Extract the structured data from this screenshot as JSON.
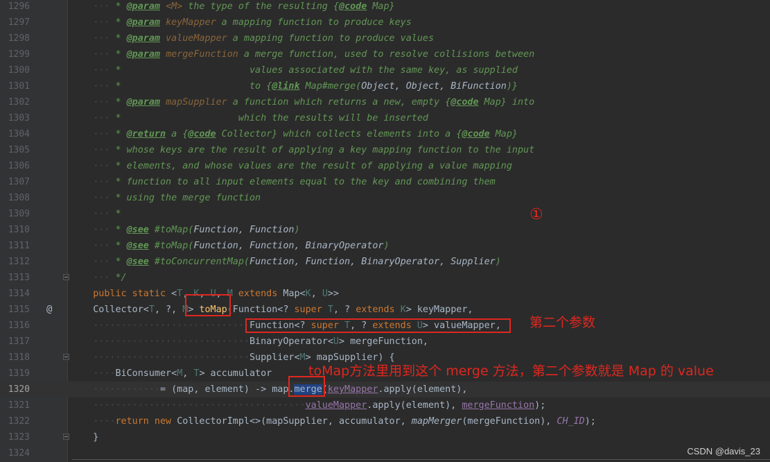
{
  "lines": [
    {
      "n": "1296",
      "tokens": [
        [
          "ws",
          "    ···"
        ],
        [
          "doc",
          " * "
        ],
        [
          "tag",
          "@param"
        ],
        [
          "doc",
          " "
        ],
        [
          "param",
          "<M>"
        ],
        [
          "doc",
          " the type of the resulting {"
        ],
        [
          "tag",
          "@code"
        ],
        [
          "doc",
          " Map}"
        ]
      ]
    },
    {
      "n": "1297",
      "tokens": [
        [
          "ws",
          "    ···"
        ],
        [
          "doc",
          " * "
        ],
        [
          "tag",
          "@param"
        ],
        [
          "doc",
          " "
        ],
        [
          "param",
          "keyMapper"
        ],
        [
          "doc",
          " a mapping function to produce keys"
        ]
      ]
    },
    {
      "n": "1298",
      "tokens": [
        [
          "ws",
          "    ···"
        ],
        [
          "doc",
          " * "
        ],
        [
          "tag",
          "@param"
        ],
        [
          "doc",
          " "
        ],
        [
          "param",
          "valueMapper"
        ],
        [
          "doc",
          " a mapping function to produce values"
        ]
      ]
    },
    {
      "n": "1299",
      "tokens": [
        [
          "ws",
          "    ···"
        ],
        [
          "doc",
          " * "
        ],
        [
          "tag",
          "@param"
        ],
        [
          "doc",
          " "
        ],
        [
          "param",
          "mergeFunction"
        ],
        [
          "doc",
          " a merge function, used to resolve collisions between"
        ]
      ]
    },
    {
      "n": "1300",
      "tokens": [
        [
          "ws",
          "    ···"
        ],
        [
          "doc",
          " *                       values associated with the same key, as supplied"
        ]
      ]
    },
    {
      "n": "1301",
      "tokens": [
        [
          "ws",
          "    ···"
        ],
        [
          "doc",
          " *                       to {"
        ],
        [
          "tag",
          "@link"
        ],
        [
          "doc",
          " Map#"
        ],
        [
          "doc",
          "merge"
        ],
        [
          "doc",
          "("
        ],
        [
          "it",
          "Object, Object, BiFunction"
        ],
        [
          "doc",
          ")}"
        ]
      ]
    },
    {
      "n": "1302",
      "tokens": [
        [
          "ws",
          "    ···"
        ],
        [
          "doc",
          " * "
        ],
        [
          "tag",
          "@param"
        ],
        [
          "doc",
          " "
        ],
        [
          "param",
          "mapSupplier"
        ],
        [
          "doc",
          " a function which returns a new, empty {"
        ],
        [
          "tag",
          "@code"
        ],
        [
          "doc",
          " Map} into"
        ]
      ]
    },
    {
      "n": "1303",
      "tokens": [
        [
          "ws",
          "    ···"
        ],
        [
          "doc",
          " *                     which the results will be inserted"
        ]
      ]
    },
    {
      "n": "1304",
      "tokens": [
        [
          "ws",
          "    ···"
        ],
        [
          "doc",
          " * "
        ],
        [
          "tag",
          "@return"
        ],
        [
          "doc",
          " a {"
        ],
        [
          "tag",
          "@code"
        ],
        [
          "doc",
          " Collector} which collects elements into a {"
        ],
        [
          "tag",
          "@code"
        ],
        [
          "doc",
          " Map}"
        ]
      ]
    },
    {
      "n": "1305",
      "tokens": [
        [
          "ws",
          "    ···"
        ],
        [
          "doc",
          " * whose keys are the result of applying a key mapping function to the input"
        ]
      ]
    },
    {
      "n": "1306",
      "tokens": [
        [
          "ws",
          "    ···"
        ],
        [
          "doc",
          " * elements, and whose values are the result of applying a value mapping"
        ]
      ]
    },
    {
      "n": "1307",
      "tokens": [
        [
          "ws",
          "    ···"
        ],
        [
          "doc",
          " * function to all input elements equal to the key and combining them"
        ]
      ]
    },
    {
      "n": "1308",
      "tokens": [
        [
          "ws",
          "    ···"
        ],
        [
          "doc",
          " * using the merge function"
        ]
      ]
    },
    {
      "n": "1309",
      "tokens": [
        [
          "ws",
          "    ···"
        ],
        [
          "doc",
          " *"
        ]
      ]
    },
    {
      "n": "1310",
      "tokens": [
        [
          "ws",
          "    ···"
        ],
        [
          "doc",
          " * "
        ],
        [
          "tag",
          "@see"
        ],
        [
          "doc",
          " #toMap("
        ],
        [
          "it",
          "Function, Function"
        ],
        [
          "doc",
          ")"
        ]
      ]
    },
    {
      "n": "1311",
      "tokens": [
        [
          "ws",
          "    ···"
        ],
        [
          "doc",
          " * "
        ],
        [
          "tag",
          "@see"
        ],
        [
          "doc",
          " #toMap("
        ],
        [
          "it",
          "Function, Function, BinaryOperator"
        ],
        [
          "doc",
          ")"
        ]
      ]
    },
    {
      "n": "1312",
      "tokens": [
        [
          "ws",
          "    ···"
        ],
        [
          "doc",
          " * "
        ],
        [
          "tag",
          "@see"
        ],
        [
          "doc",
          " #toConcurrentMap("
        ],
        [
          "it",
          "Function, Function, BinaryOperator, Supplier"
        ],
        [
          "doc",
          ")"
        ]
      ]
    },
    {
      "n": "1313",
      "tokens": [
        [
          "ws",
          "    ···"
        ],
        [
          "doc",
          " */"
        ]
      ]
    },
    {
      "n": "1314",
      "tokens": [
        [
          "ws",
          "    "
        ],
        [
          "kw",
          "public static "
        ],
        [
          "plain",
          "<"
        ],
        [
          "tp",
          "T"
        ],
        [
          "plain",
          ", "
        ],
        [
          "tp",
          "K"
        ],
        [
          "plain",
          ", "
        ],
        [
          "tp",
          "U"
        ],
        [
          "plain",
          ", "
        ],
        [
          "tp",
          "M "
        ],
        [
          "kw",
          "extends "
        ],
        [
          "plain",
          "Map<"
        ],
        [
          "tp",
          "K"
        ],
        [
          "plain",
          ", "
        ],
        [
          "tp",
          "U"
        ],
        [
          "plain",
          ">>"
        ]
      ]
    },
    {
      "n": "1315",
      "tokens": [
        [
          "ws",
          "    "
        ],
        [
          "plain",
          "Collector<"
        ],
        [
          "tp",
          "T"
        ],
        [
          "plain",
          ", ?, "
        ],
        [
          "tp",
          "M"
        ],
        [
          "plain",
          "> "
        ],
        [
          "fn",
          "toMap"
        ],
        [
          "plain",
          "(Function<? "
        ],
        [
          "kw",
          "super "
        ],
        [
          "tp",
          "T"
        ],
        [
          "plain",
          ", ? "
        ],
        [
          "kw",
          "extends "
        ],
        [
          "tp",
          "K"
        ],
        [
          "plain",
          "> keyMapper,"
        ]
      ]
    },
    {
      "n": "1316",
      "tokens": [
        [
          "ws",
          "    ····························"
        ],
        [
          "plain",
          "Function<? "
        ],
        [
          "kw",
          "super "
        ],
        [
          "tp",
          "T"
        ],
        [
          "plain",
          ", ? "
        ],
        [
          "kw",
          "extends "
        ],
        [
          "tp",
          "U"
        ],
        [
          "plain",
          "> valueMapper,"
        ]
      ]
    },
    {
      "n": "1317",
      "tokens": [
        [
          "ws",
          "    ····························"
        ],
        [
          "plain",
          "BinaryOperator<"
        ],
        [
          "tp",
          "U"
        ],
        [
          "plain",
          "> mergeFunction,"
        ]
      ]
    },
    {
      "n": "1318",
      "tokens": [
        [
          "ws",
          "    ····························"
        ],
        [
          "plain",
          "Supplier<"
        ],
        [
          "tp",
          "M"
        ],
        [
          "plain",
          "> mapSupplier) {"
        ]
      ]
    },
    {
      "n": "1319",
      "tokens": [
        [
          "ws",
          "    ····"
        ],
        [
          "plain",
          "BiConsumer<"
        ],
        [
          "tp",
          "M"
        ],
        [
          "plain",
          ", "
        ],
        [
          "tp",
          "T"
        ],
        [
          "plain",
          "> accumulator"
        ]
      ]
    },
    {
      "n": "1320",
      "tokens": [
        [
          "ws",
          "    ············"
        ],
        [
          "plain",
          "= (map, element) -> map."
        ],
        [
          "hl",
          "merge"
        ],
        [
          "plain",
          "("
        ],
        [
          "ref",
          "keyMapper"
        ],
        [
          "plain",
          ".apply(element),"
        ]
      ]
    },
    {
      "n": "1321",
      "tokens": [
        [
          "ws",
          "    ······································"
        ],
        [
          "ref",
          "valueMapper"
        ],
        [
          "plain",
          ".apply(element), "
        ],
        [
          "ref",
          "mergeFunction"
        ],
        [
          "plain",
          ");"
        ]
      ]
    },
    {
      "n": "1322",
      "tokens": [
        [
          "ws",
          "    ····"
        ],
        [
          "kw",
          "return new "
        ],
        [
          "plain",
          "CollectorImpl<>(mapSupplier, accumulator, "
        ],
        [
          "it",
          "mapMerger"
        ],
        [
          "plain",
          "(mergeFunction), "
        ],
        [
          "field",
          "CH_ID"
        ],
        [
          "plain",
          ");"
        ]
      ]
    },
    {
      "n": "1323",
      "tokens": [
        [
          "ws",
          "    "
        ],
        [
          "plain",
          "}"
        ]
      ]
    },
    {
      "n": "1324",
      "tokens": []
    }
  ],
  "current_line": "1320",
  "override_marker": "@",
  "annotations": {
    "circle_number": "①",
    "second_param": "第二个参数",
    "merge_note": "toMap方法里用到这个 merge 方法，第二个参数就是 Map 的 value"
  },
  "watermark": "CSDN @davis_23",
  "colors": {
    "background": "#2b2b2b",
    "gutter": "#313335",
    "doc_comment": "#629755",
    "keyword": "#cc7832",
    "method_decl": "#ffc66d",
    "annotation_red": "#e0271f",
    "selection": "#214283"
  }
}
